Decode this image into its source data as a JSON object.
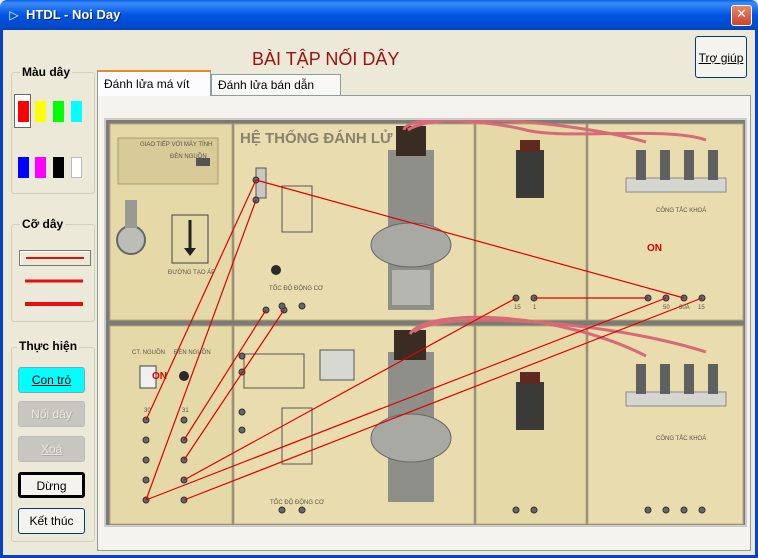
{
  "window": {
    "title": "HTDL - Noi Day",
    "icon": "app-icon",
    "close_icon": "close-icon"
  },
  "heading": "BÀI TẬP NỐI DÂY",
  "help_button": "Trợ giúp",
  "wire_color": {
    "label": "Màu dây",
    "selected": "#ff0000",
    "swatches": [
      "#ff0000",
      "#ffff00",
      "#00ff00",
      "#00ffff",
      "#0000ff",
      "#ff00ff",
      "#000000",
      "#ffffff"
    ]
  },
  "wire_size": {
    "label": "Cỡ dây",
    "selected_index": 0,
    "options": [
      "thin",
      "medium",
      "thick"
    ]
  },
  "actions": {
    "label": "Thực hiện",
    "pointer": "Con trỏ",
    "connect": "Nối dây",
    "delete": "Xoá",
    "stop": "Dừng",
    "exit": "Kết thúc"
  },
  "tabs": [
    {
      "label": "Đánh lửa má vít",
      "active": true
    },
    {
      "label": "Đánh lửa bán dẫn",
      "active": false
    }
  ],
  "board": {
    "title": "HỆ THỐNG ĐÁNH LỬ",
    "labels": {
      "power": "CT. NGUỒN",
      "power_lamp": "ĐÈN NGUỒN",
      "power_lamp_top": "ĐÈN NGUỒN",
      "high_voltage": "ĐƯỜNG TẠO ÁP",
      "engine_speed_top": "TỐC ĐỘ ĐỘNG CƠ",
      "engine_speed_bottom": "TỐC ĐỘ ĐỘNG CƠ",
      "key_switch_top": "CÔNG TẮC KHOÁ",
      "key_switch_bottom": "CÔNG TẮC KHOÁ",
      "computer_link": "GIAO TIẾP VỚI MÁY TÍNH",
      "on_top": "ON",
      "on_bottom": "ON",
      "term_30": "30",
      "term_31": "31",
      "term_15": "15",
      "term_1": "1",
      "term_15_2": "15",
      "term_50": "50",
      "term_30a": "30A"
    }
  }
}
